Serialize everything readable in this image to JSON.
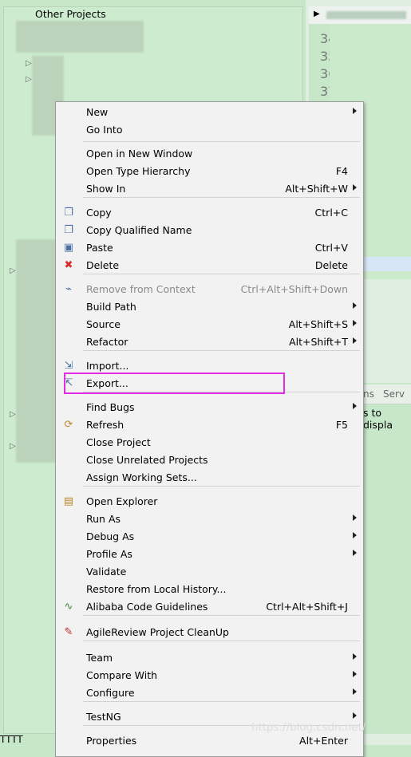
{
  "tree": {
    "header": "Other Projects",
    "bottom_text": "TTTT"
  },
  "editor": {
    "line_numbers": [
      "34",
      "35",
      "36",
      "37"
    ],
    "tabs": [
      "ns",
      "Serv"
    ],
    "hint": "s to displa"
  },
  "menu": {
    "items": [
      {
        "label": "New",
        "submenu": true
      },
      {
        "label": "Go Into"
      },
      {
        "label": "Open in New Window"
      },
      {
        "label": "Open Type Hierarchy",
        "shortcut": "F4"
      },
      {
        "label": "Show In",
        "shortcut": "Alt+Shift+W",
        "submenu": true
      },
      {
        "label": "Copy",
        "shortcut": "Ctrl+C",
        "icon": "copy-icon"
      },
      {
        "label": "Copy Qualified Name",
        "icon": "copy-qualified-name-icon"
      },
      {
        "label": "Paste",
        "shortcut": "Ctrl+V",
        "icon": "paste-icon"
      },
      {
        "label": "Delete",
        "shortcut": "Delete",
        "icon": "delete-icon"
      },
      {
        "label": "Remove from Context",
        "shortcut": "Ctrl+Alt+Shift+Down",
        "disabled": true,
        "icon": "remove-context-icon"
      },
      {
        "label": "Build Path",
        "submenu": true
      },
      {
        "label": "Source",
        "shortcut": "Alt+Shift+S",
        "submenu": true
      },
      {
        "label": "Refactor",
        "shortcut": "Alt+Shift+T",
        "submenu": true
      },
      {
        "label": "Import...",
        "icon": "import-icon"
      },
      {
        "label": "Export...",
        "icon": "export-icon"
      },
      {
        "label": "Find Bugs",
        "submenu": true
      },
      {
        "label": "Refresh",
        "shortcut": "F5",
        "icon": "refresh-icon"
      },
      {
        "label": "Close Project"
      },
      {
        "label": "Close Unrelated Projects"
      },
      {
        "label": "Assign Working Sets..."
      },
      {
        "label": "Open Explorer",
        "icon": "open-explorer-icon"
      },
      {
        "label": "Run As",
        "submenu": true
      },
      {
        "label": "Debug As",
        "submenu": true
      },
      {
        "label": "Profile As",
        "submenu": true
      },
      {
        "label": "Validate"
      },
      {
        "label": "Restore from Local History..."
      },
      {
        "label": "Alibaba Code Guidelines",
        "shortcut": "Ctrl+Alt+Shift+J",
        "icon": "alibaba-guidelines-icon"
      },
      {
        "label": "AgileReview Project CleanUp",
        "icon": "agilereview-icon"
      },
      {
        "label": "Team",
        "submenu": true
      },
      {
        "label": "Compare With",
        "submenu": true
      },
      {
        "label": "Configure",
        "submenu": true
      },
      {
        "label": "TestNG",
        "submenu": true
      },
      {
        "label": "Properties",
        "shortcut": "Alt+Enter"
      }
    ]
  },
  "watermark": "https://blog.csdn.net/..."
}
